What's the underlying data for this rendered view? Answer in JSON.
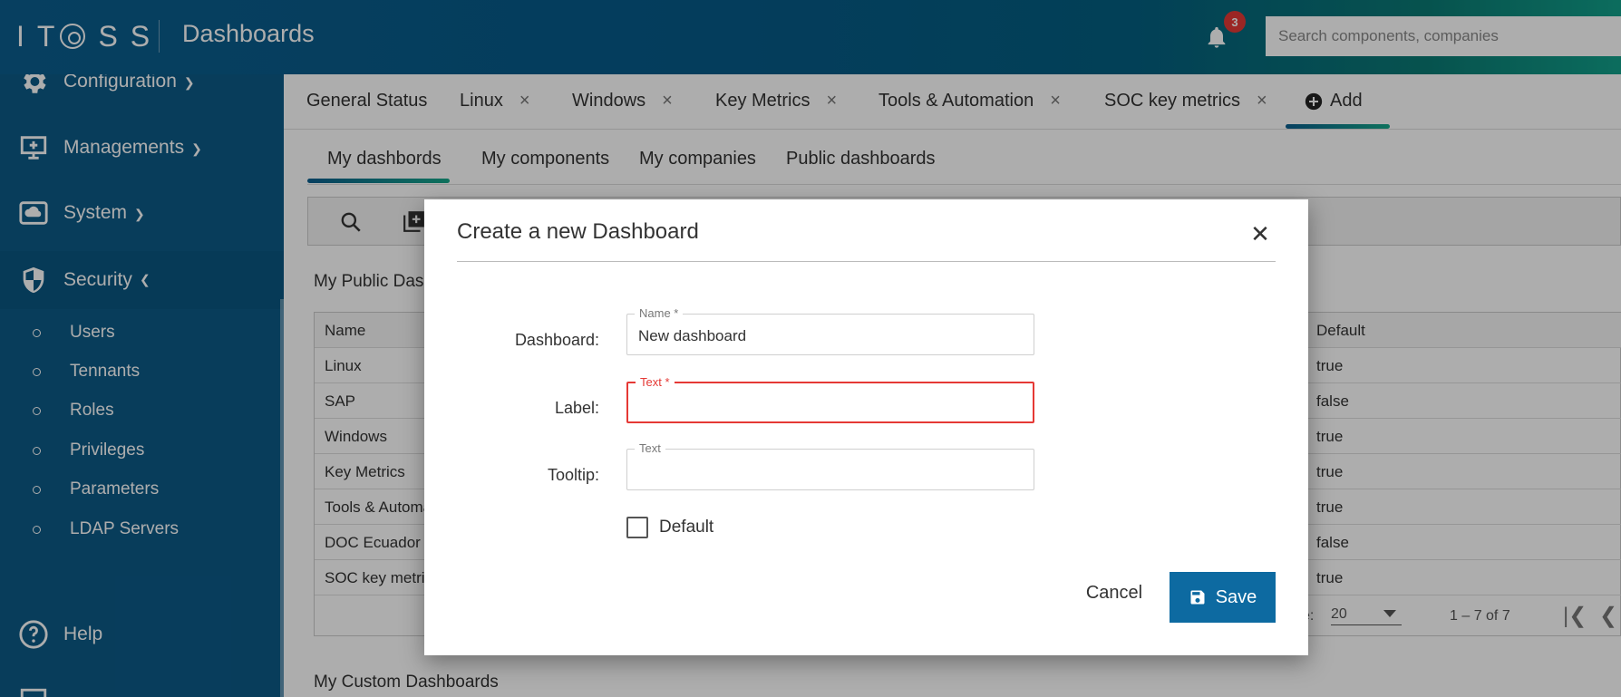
{
  "header": {
    "logo_text": "ITOSS",
    "title": "Dashboards",
    "notifications_count": "3",
    "search_placeholder": "Search components, companies"
  },
  "sidebar": {
    "groups": [
      {
        "label": "Configuration",
        "icon": "gear-icon"
      },
      {
        "label": "Managements",
        "icon": "monitor-plus-icon"
      },
      {
        "label": "System",
        "icon": "cloud-icon"
      },
      {
        "label": "Security",
        "icon": "shield-icon"
      }
    ],
    "security_items": [
      "Users",
      "Tennants",
      "Roles",
      "Privileges",
      "Parameters",
      "LDAP Servers"
    ],
    "help": "Help",
    "accent": "#0c5a87"
  },
  "top_tabs": [
    {
      "label": "General Status",
      "closable": false
    },
    {
      "label": "Linux",
      "closable": true
    },
    {
      "label": "Windows",
      "closable": true
    },
    {
      "label": "Key Metrics",
      "closable": true
    },
    {
      "label": "Tools & Automation",
      "closable": true
    },
    {
      "label": "SOC key metrics",
      "closable": true
    },
    {
      "label": "Add",
      "closable": false
    }
  ],
  "sub_tabs": [
    "My dashbords",
    "My components",
    "My companies",
    "Public dashboards"
  ],
  "public_section_title": "My Public Das",
  "table": {
    "headers": [
      "Name",
      "Default"
    ],
    "rows": [
      [
        "Linux",
        "true"
      ],
      [
        "SAP",
        "false"
      ],
      [
        "Windows",
        "true"
      ],
      [
        "Key Metrics",
        "true"
      ],
      [
        "Tools & Automa",
        "true"
      ],
      [
        "DOC Ecuador",
        "false"
      ],
      [
        "SOC key metric",
        "true"
      ]
    ]
  },
  "pager": {
    "label_fragment": "e:",
    "page_size": "20",
    "range": "1 – 7 of 7"
  },
  "custom_section_title": "My Custom Dashboards",
  "dialog": {
    "title": "Create a new Dashboard",
    "dashboard_label": "Dashboard:",
    "name_field_label": "Name *",
    "name_value": "New dashboard",
    "label_label": "Label:",
    "text_field_label": "Text *",
    "text_value": "",
    "tooltip_label": "Tooltip:",
    "tooltip_field_label": "Text",
    "tooltip_value": "",
    "default_checkbox_label": "Default",
    "default_checked": false,
    "cancel": "Cancel",
    "save": "Save",
    "error_color": "#e53935",
    "save_color": "#0d6aa1"
  }
}
